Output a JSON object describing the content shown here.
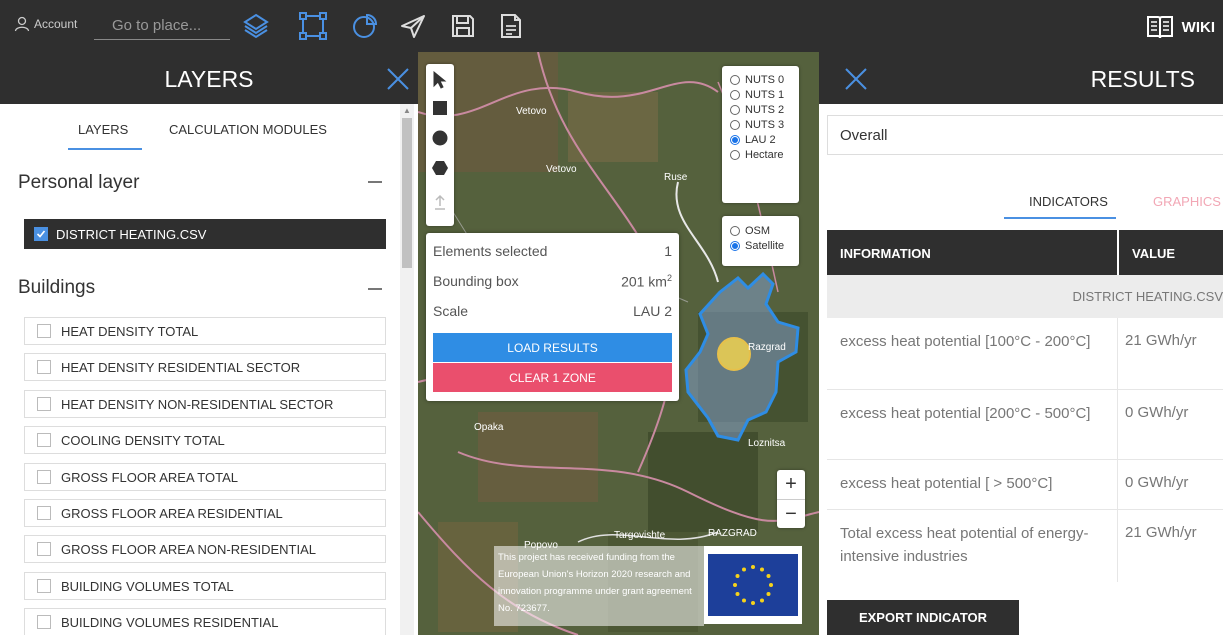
{
  "topbar": {
    "account_label": "Account",
    "goto_placeholder": "Go to place...",
    "wiki_label": "WIKI",
    "accent": "#4a90e2"
  },
  "left_panel": {
    "title": "LAYERS",
    "tabs": [
      {
        "label": "LAYERS",
        "active": true
      },
      {
        "label": "CALCULATION MODULES",
        "active": false
      }
    ],
    "personal_section": "Personal layer",
    "personal_layers": [
      {
        "label": "DISTRICT HEATING.CSV",
        "checked": true
      }
    ],
    "buildings_section": "Buildings",
    "building_layers": [
      {
        "label": "HEAT DENSITY TOTAL",
        "checked": false
      },
      {
        "label": "HEAT DENSITY RESIDENTIAL SECTOR",
        "checked": false
      },
      {
        "label": "HEAT DENSITY NON-RESIDENTIAL SECTOR",
        "checked": false
      },
      {
        "label": "COOLING DENSITY TOTAL",
        "checked": false
      },
      {
        "label": "GROSS FLOOR AREA TOTAL",
        "checked": false
      },
      {
        "label": "GROSS FLOOR AREA RESIDENTIAL",
        "checked": false
      },
      {
        "label": "GROSS FLOOR AREA NON-RESIDENTIAL",
        "checked": false
      },
      {
        "label": "BUILDING VOLUMES TOTAL",
        "checked": false
      },
      {
        "label": "BUILDING VOLUMES RESIDENTIAL",
        "checked": false
      }
    ]
  },
  "map": {
    "scale_options": [
      {
        "label": "NUTS 0",
        "selected": false
      },
      {
        "label": "NUTS 1",
        "selected": false
      },
      {
        "label": "NUTS 2",
        "selected": false
      },
      {
        "label": "NUTS 3",
        "selected": false
      },
      {
        "label": "LAU 2",
        "selected": true
      },
      {
        "label": "Hectare",
        "selected": false
      }
    ],
    "basemap_options": [
      {
        "label": "OSM",
        "selected": false
      },
      {
        "label": "Satellite",
        "selected": true
      }
    ],
    "selection": {
      "elements_label": "Elements selected",
      "elements_value": "1",
      "bbox_label": "Bounding box",
      "bbox_value": "201 km",
      "bbox_unit_sup": "2",
      "scale_label": "Scale",
      "scale_value": "LAU 2",
      "load_button": "LOAD RESULTS",
      "clear_button": "CLEAR 1 ZONE"
    },
    "place_labels": [
      "Vetovo",
      "Opaka",
      "Popovo",
      "Razgrad",
      "RAZGRAD",
      "Loznitsa",
      "Targovishte",
      "Ruse",
      "Vetovo"
    ],
    "zoom_in": "+",
    "zoom_out": "−",
    "funding_text": "This project has received funding from the European Union's Horizon 2020 research and innovation programme under grant agreement No. 723677."
  },
  "right_panel": {
    "title": "RESULTS",
    "overall_label": "Overall",
    "tabs": [
      {
        "label": "INDICATORS",
        "active": true
      },
      {
        "label": "GRAPHICS",
        "active": false
      }
    ],
    "table": {
      "col_info": "INFORMATION",
      "col_value": "VALUE",
      "group_label": "DISTRICT HEATING.CSV",
      "rows": [
        {
          "info": "excess heat potential [100°C - 200°C]",
          "value": "21 GWh/yr"
        },
        {
          "info": "excess heat potential [200°C - 500°C]",
          "value": "0 GWh/yr"
        },
        {
          "info": "excess heat potential [ > 500°C]",
          "value": "0 GWh/yr"
        },
        {
          "info": "Total excess heat potential of energy-intensive industries",
          "value": "21 GWh/yr"
        }
      ]
    },
    "export_button": "EXPORT INDICATOR",
    "graphics_color": "#f2a7b5"
  }
}
